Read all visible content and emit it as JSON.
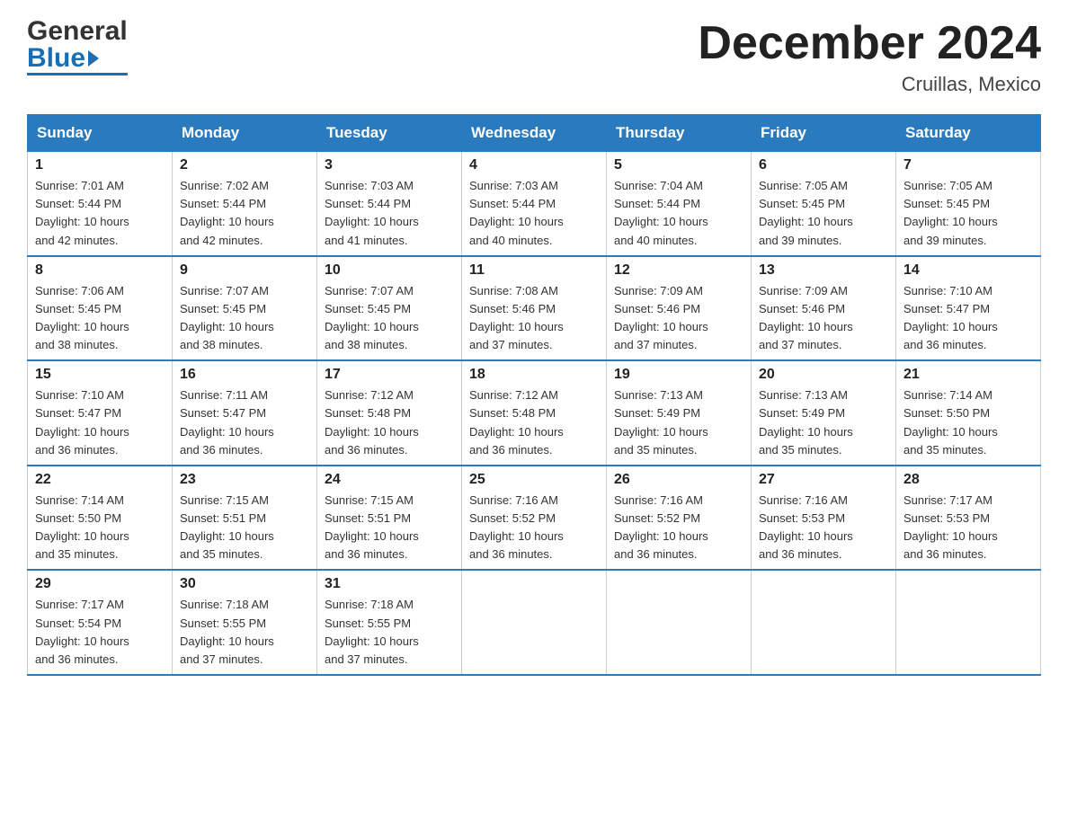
{
  "header": {
    "month_title": "December 2024",
    "subtitle": "Cruillas, Mexico",
    "logo_general": "General",
    "logo_blue": "Blue"
  },
  "days_of_week": [
    "Sunday",
    "Monday",
    "Tuesday",
    "Wednesday",
    "Thursday",
    "Friday",
    "Saturday"
  ],
  "weeks": [
    [
      {
        "day": "1",
        "sunrise": "7:01 AM",
        "sunset": "5:44 PM",
        "daylight": "10 hours and 42 minutes."
      },
      {
        "day": "2",
        "sunrise": "7:02 AM",
        "sunset": "5:44 PM",
        "daylight": "10 hours and 42 minutes."
      },
      {
        "day": "3",
        "sunrise": "7:03 AM",
        "sunset": "5:44 PM",
        "daylight": "10 hours and 41 minutes."
      },
      {
        "day": "4",
        "sunrise": "7:03 AM",
        "sunset": "5:44 PM",
        "daylight": "10 hours and 40 minutes."
      },
      {
        "day": "5",
        "sunrise": "7:04 AM",
        "sunset": "5:44 PM",
        "daylight": "10 hours and 40 minutes."
      },
      {
        "day": "6",
        "sunrise": "7:05 AM",
        "sunset": "5:45 PM",
        "daylight": "10 hours and 39 minutes."
      },
      {
        "day": "7",
        "sunrise": "7:05 AM",
        "sunset": "5:45 PM",
        "daylight": "10 hours and 39 minutes."
      }
    ],
    [
      {
        "day": "8",
        "sunrise": "7:06 AM",
        "sunset": "5:45 PM",
        "daylight": "10 hours and 38 minutes."
      },
      {
        "day": "9",
        "sunrise": "7:07 AM",
        "sunset": "5:45 PM",
        "daylight": "10 hours and 38 minutes."
      },
      {
        "day": "10",
        "sunrise": "7:07 AM",
        "sunset": "5:45 PM",
        "daylight": "10 hours and 38 minutes."
      },
      {
        "day": "11",
        "sunrise": "7:08 AM",
        "sunset": "5:46 PM",
        "daylight": "10 hours and 37 minutes."
      },
      {
        "day": "12",
        "sunrise": "7:09 AM",
        "sunset": "5:46 PM",
        "daylight": "10 hours and 37 minutes."
      },
      {
        "day": "13",
        "sunrise": "7:09 AM",
        "sunset": "5:46 PM",
        "daylight": "10 hours and 37 minutes."
      },
      {
        "day": "14",
        "sunrise": "7:10 AM",
        "sunset": "5:47 PM",
        "daylight": "10 hours and 36 minutes."
      }
    ],
    [
      {
        "day": "15",
        "sunrise": "7:10 AM",
        "sunset": "5:47 PM",
        "daylight": "10 hours and 36 minutes."
      },
      {
        "day": "16",
        "sunrise": "7:11 AM",
        "sunset": "5:47 PM",
        "daylight": "10 hours and 36 minutes."
      },
      {
        "day": "17",
        "sunrise": "7:12 AM",
        "sunset": "5:48 PM",
        "daylight": "10 hours and 36 minutes."
      },
      {
        "day": "18",
        "sunrise": "7:12 AM",
        "sunset": "5:48 PM",
        "daylight": "10 hours and 36 minutes."
      },
      {
        "day": "19",
        "sunrise": "7:13 AM",
        "sunset": "5:49 PM",
        "daylight": "10 hours and 35 minutes."
      },
      {
        "day": "20",
        "sunrise": "7:13 AM",
        "sunset": "5:49 PM",
        "daylight": "10 hours and 35 minutes."
      },
      {
        "day": "21",
        "sunrise": "7:14 AM",
        "sunset": "5:50 PM",
        "daylight": "10 hours and 35 minutes."
      }
    ],
    [
      {
        "day": "22",
        "sunrise": "7:14 AM",
        "sunset": "5:50 PM",
        "daylight": "10 hours and 35 minutes."
      },
      {
        "day": "23",
        "sunrise": "7:15 AM",
        "sunset": "5:51 PM",
        "daylight": "10 hours and 35 minutes."
      },
      {
        "day": "24",
        "sunrise": "7:15 AM",
        "sunset": "5:51 PM",
        "daylight": "10 hours and 36 minutes."
      },
      {
        "day": "25",
        "sunrise": "7:16 AM",
        "sunset": "5:52 PM",
        "daylight": "10 hours and 36 minutes."
      },
      {
        "day": "26",
        "sunrise": "7:16 AM",
        "sunset": "5:52 PM",
        "daylight": "10 hours and 36 minutes."
      },
      {
        "day": "27",
        "sunrise": "7:16 AM",
        "sunset": "5:53 PM",
        "daylight": "10 hours and 36 minutes."
      },
      {
        "day": "28",
        "sunrise": "7:17 AM",
        "sunset": "5:53 PM",
        "daylight": "10 hours and 36 minutes."
      }
    ],
    [
      {
        "day": "29",
        "sunrise": "7:17 AM",
        "sunset": "5:54 PM",
        "daylight": "10 hours and 36 minutes."
      },
      {
        "day": "30",
        "sunrise": "7:18 AM",
        "sunset": "5:55 PM",
        "daylight": "10 hours and 37 minutes."
      },
      {
        "day": "31",
        "sunrise": "7:18 AM",
        "sunset": "5:55 PM",
        "daylight": "10 hours and 37 minutes."
      },
      null,
      null,
      null,
      null
    ]
  ],
  "labels": {
    "sunrise": "Sunrise:",
    "sunset": "Sunset:",
    "daylight": "Daylight:"
  }
}
